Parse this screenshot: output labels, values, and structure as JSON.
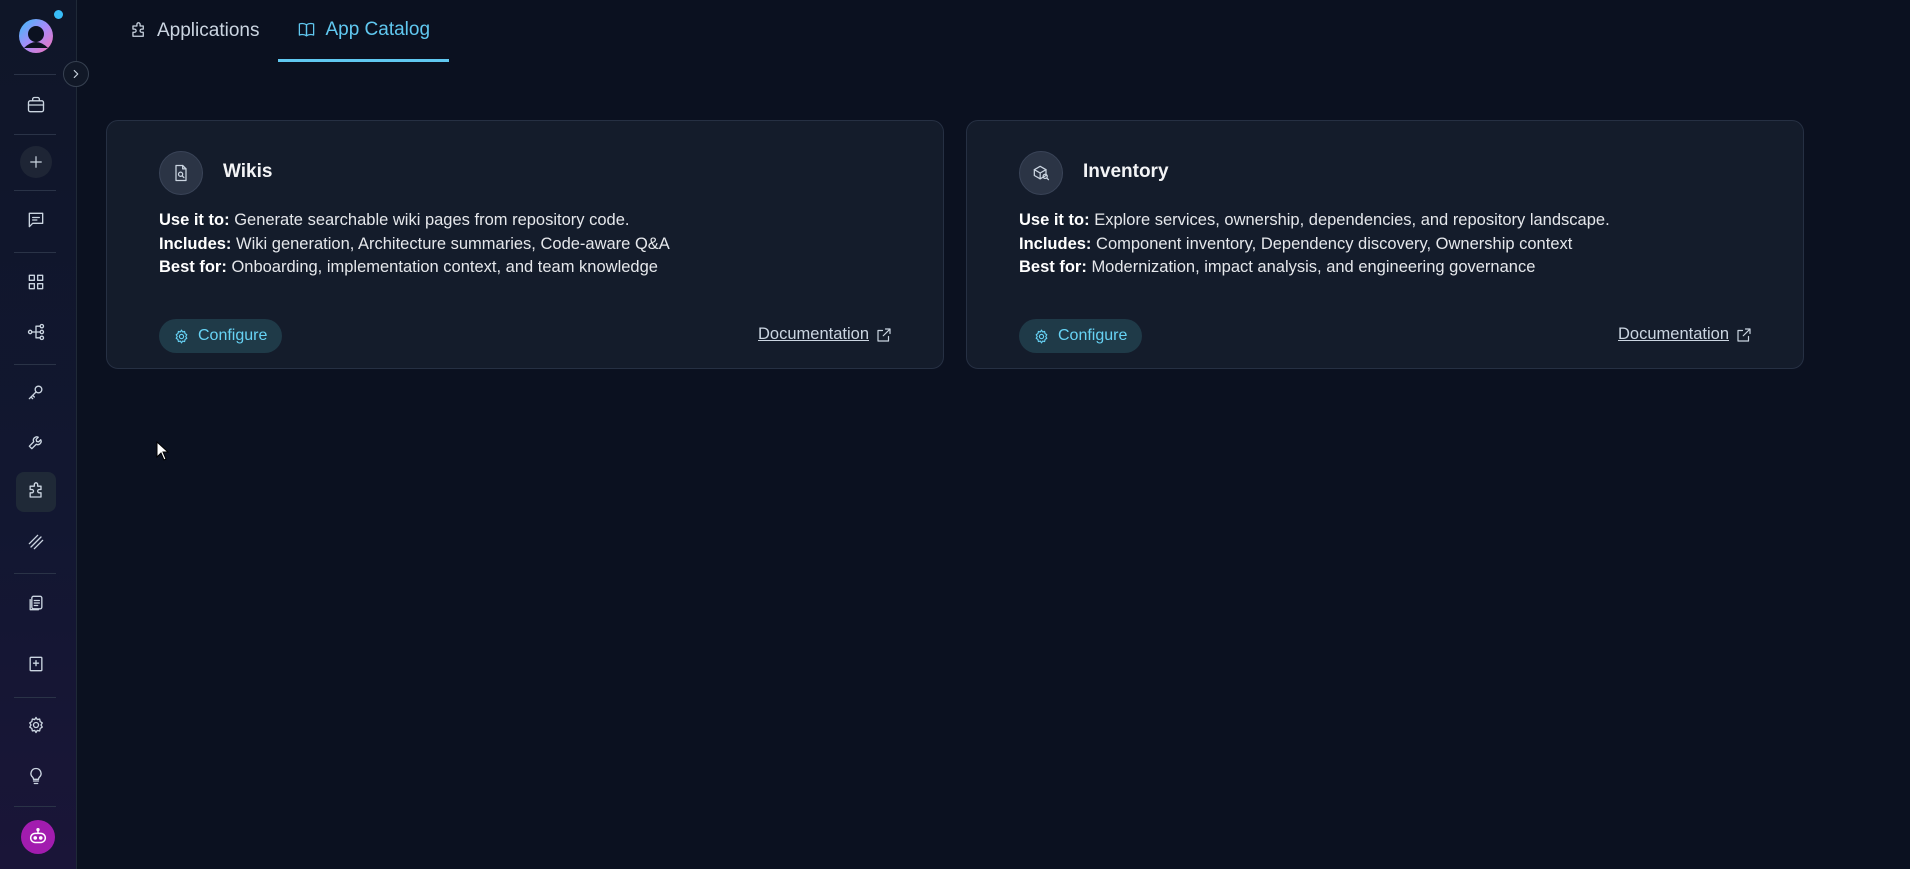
{
  "sidebar": {
    "icons": [
      {
        "name": "briefcase-icon"
      },
      {
        "name": "plus-icon"
      },
      {
        "name": "chat-icon"
      },
      {
        "name": "grid-icon"
      },
      {
        "name": "workflow-icon"
      },
      {
        "name": "key-icon"
      },
      {
        "name": "wrench-icon"
      },
      {
        "name": "puzzle-icon",
        "active": true
      },
      {
        "name": "layers-icon"
      },
      {
        "name": "documents-icon"
      },
      {
        "name": "sparkle-book-icon"
      },
      {
        "name": "gear-icon"
      },
      {
        "name": "lightbulb-icon"
      }
    ],
    "avatar": "robot-avatar-icon",
    "colors": {
      "accent": "#60c8f0",
      "avatar_bg": "#a21caf",
      "notification_dot": "#38bdf8"
    }
  },
  "tabs": [
    {
      "label": "Applications",
      "icon": "puzzle-icon",
      "active": false
    },
    {
      "label": "App Catalog",
      "icon": "book-icon",
      "active": true
    }
  ],
  "cards": [
    {
      "title": "Wikis",
      "icon": "document-search-icon",
      "use_label": "Use it to:",
      "use_text": "Generate searchable wiki pages from repository code.",
      "includes_label": "Includes:",
      "includes_text": "Wiki generation, Architecture summaries, Code-aware Q&A",
      "best_label": "Best for:",
      "best_text": "Onboarding, implementation context, and team knowledge",
      "configure_label": "Configure",
      "doc_label": "Documentation"
    },
    {
      "title": "Inventory",
      "icon": "box-search-icon",
      "use_label": "Use it to:",
      "use_text": "Explore services, ownership, dependencies, and repository landscape.",
      "includes_label": "Includes:",
      "includes_text": "Component inventory, Dependency discovery, Ownership context",
      "best_label": "Best for:",
      "best_text": "Modernization, impact analysis, and engineering governance",
      "configure_label": "Configure",
      "doc_label": "Documentation"
    }
  ]
}
